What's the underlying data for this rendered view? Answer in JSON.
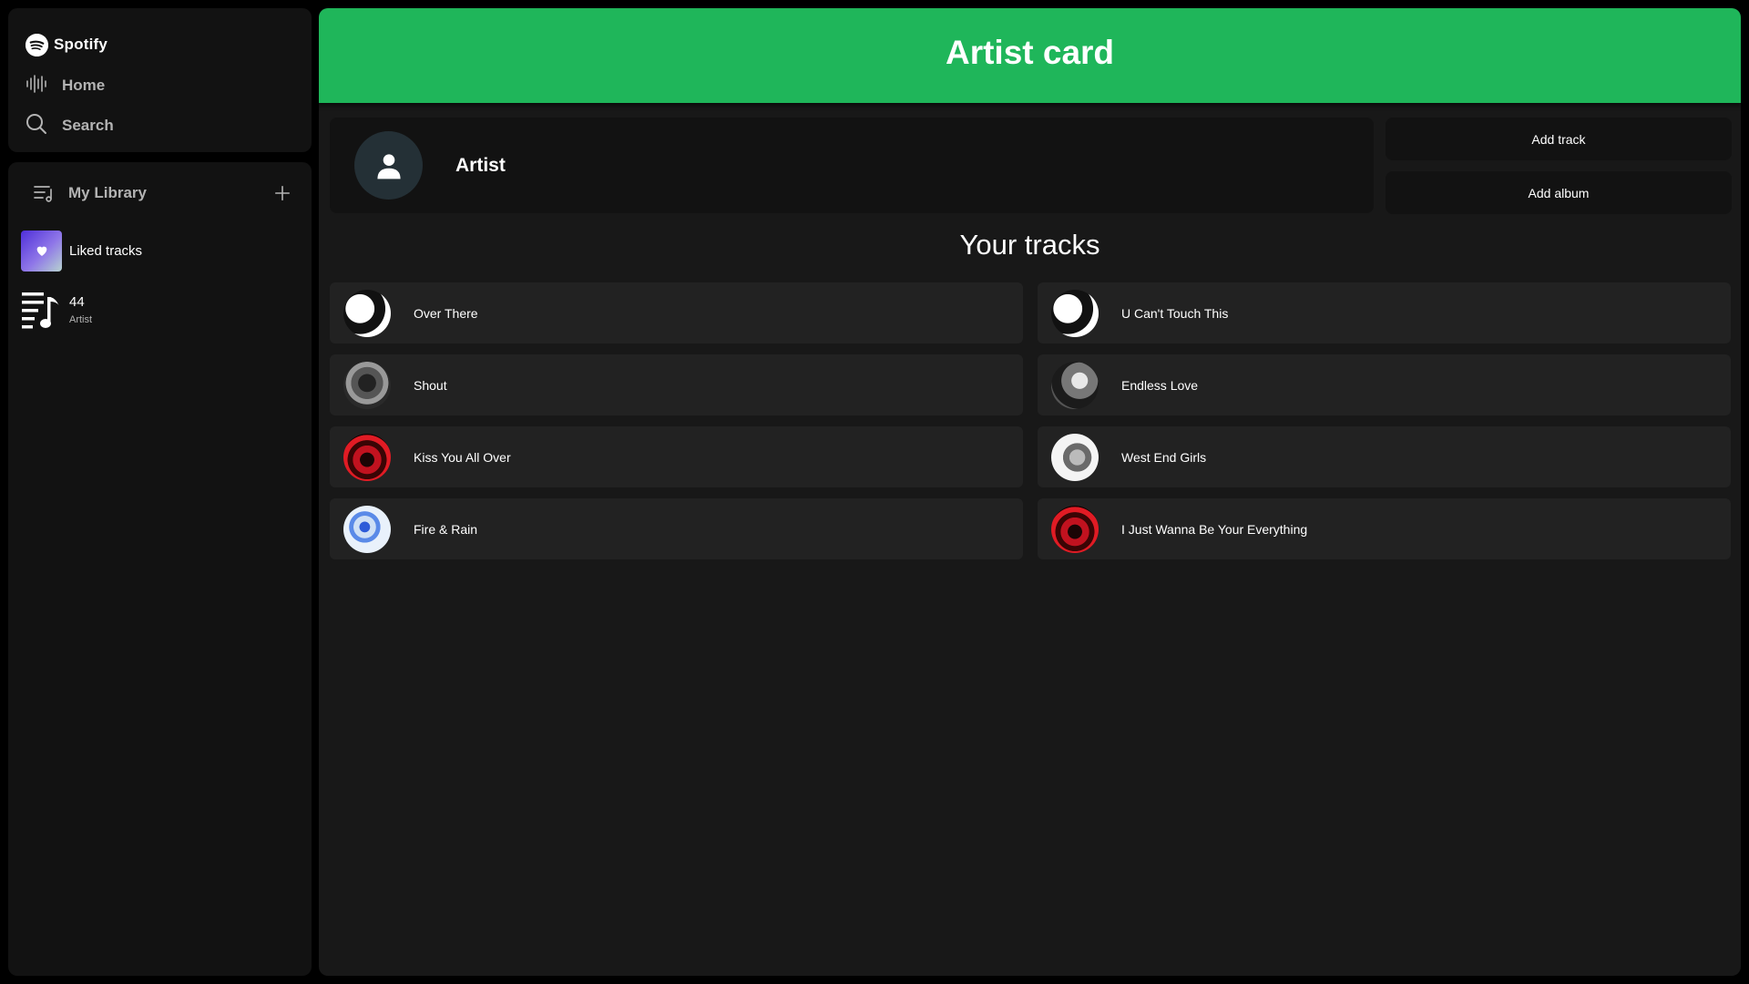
{
  "sidebar": {
    "brand": "Spotify",
    "nav": {
      "home": "Home",
      "search": "Search"
    },
    "library": {
      "title": "My Library",
      "items": [
        {
          "title": "Liked tracks",
          "subtitle": ""
        },
        {
          "title": "44",
          "subtitle": "Artist"
        }
      ]
    }
  },
  "main": {
    "banner_title": "Artist card",
    "artist": {
      "name": "Artist"
    },
    "buttons": {
      "add_track": "Add track",
      "add_album": "Add album"
    },
    "section_title": "Your tracks",
    "tracks": [
      {
        "title": "Over There"
      },
      {
        "title": "U Can't Touch This"
      },
      {
        "title": "Shout"
      },
      {
        "title": "Endless Love"
      },
      {
        "title": "Kiss You All Over"
      },
      {
        "title": "West End Girls"
      },
      {
        "title": "Fire & Rain"
      },
      {
        "title": "I Just Wanna Be Your Everything"
      }
    ]
  },
  "colors": {
    "accent_green": "#1fb65a",
    "panel": "#121212",
    "main_bg": "#181818",
    "track_bg": "#222222"
  }
}
